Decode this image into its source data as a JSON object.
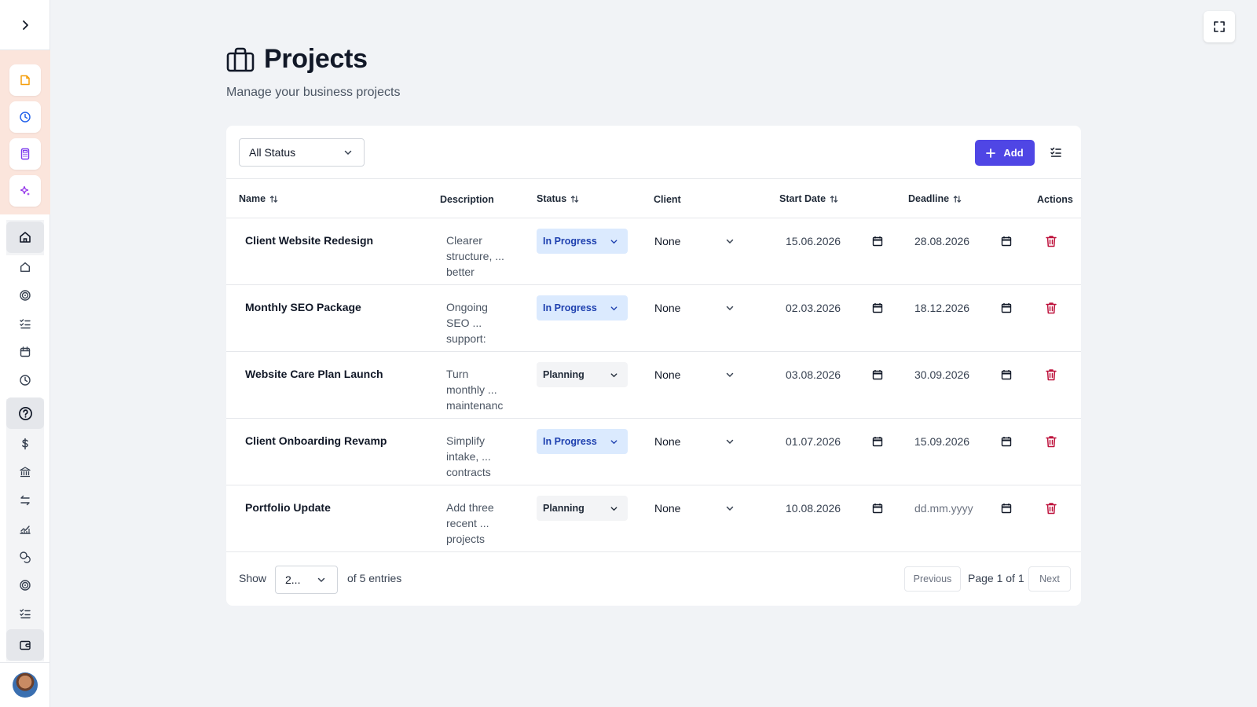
{
  "header": {
    "title": "Projects",
    "subtitle": "Manage your business projects"
  },
  "toolbar": {
    "status_filter": "All Status",
    "add_label": "Add"
  },
  "table": {
    "columns": {
      "name": "Name",
      "description": "Description",
      "status": "Status",
      "client": "Client",
      "start_date": "Start Date",
      "deadline": "Deadline",
      "actions": "Actions"
    },
    "rows": [
      {
        "name": "Client Website Redesign",
        "desc": [
          "Clearer",
          "structure, ...",
          "better"
        ],
        "status": "In Progress",
        "client": "None",
        "start": "15.06.2026",
        "deadline": "28.08.2026"
      },
      {
        "name": "Monthly SEO Package",
        "desc": [
          "Ongoing",
          "SEO ...",
          "support:"
        ],
        "status": "In Progress",
        "client": "None",
        "start": "02.03.2026",
        "deadline": "18.12.2026"
      },
      {
        "name": "Website Care Plan Launch",
        "desc": [
          "Turn",
          "monthly ...",
          "maintenanc"
        ],
        "status": "Planning",
        "client": "None",
        "start": "03.08.2026",
        "deadline": "30.09.2026"
      },
      {
        "name": "Client Onboarding Revamp",
        "desc": [
          "Simplify",
          "intake, ...",
          "contracts"
        ],
        "status": "In Progress",
        "client": "None",
        "start": "01.07.2026",
        "deadline": "15.09.2026"
      },
      {
        "name": "Portfolio Update",
        "desc": [
          "Add three",
          "recent ...",
          "projects"
        ],
        "status": "Planning",
        "client": "None",
        "start": "10.08.2026",
        "deadline": "dd.mm.yyyy"
      }
    ]
  },
  "footer": {
    "show_label": "Show",
    "page_size": "2...",
    "entries_label": "of 5 entries",
    "previous": "Previous",
    "page_info": "Page 1 of 1",
    "next": "Next"
  },
  "colors": {
    "accent": "#4f46e5",
    "in_progress_bg": "#dbeafe",
    "planning_bg": "#f3f4f6",
    "delete": "#be123c",
    "sidebar_highlight": "#fbe5dc"
  },
  "icons": {
    "sidebar_top": [
      "note-icon",
      "clock-icon",
      "calculator-icon",
      "sparkles-icon"
    ],
    "sidebar_nav": [
      "home-icon",
      "home-icon",
      "target-icon",
      "checklist-icon",
      "calendar-icon",
      "clock-icon",
      "help-circle-icon",
      "dollar-icon",
      "bank-icon",
      "arrows-exchange-icon",
      "chart-line-icon",
      "coins-icon",
      "target-icon",
      "checklist-icon",
      "wallet-icon"
    ]
  }
}
